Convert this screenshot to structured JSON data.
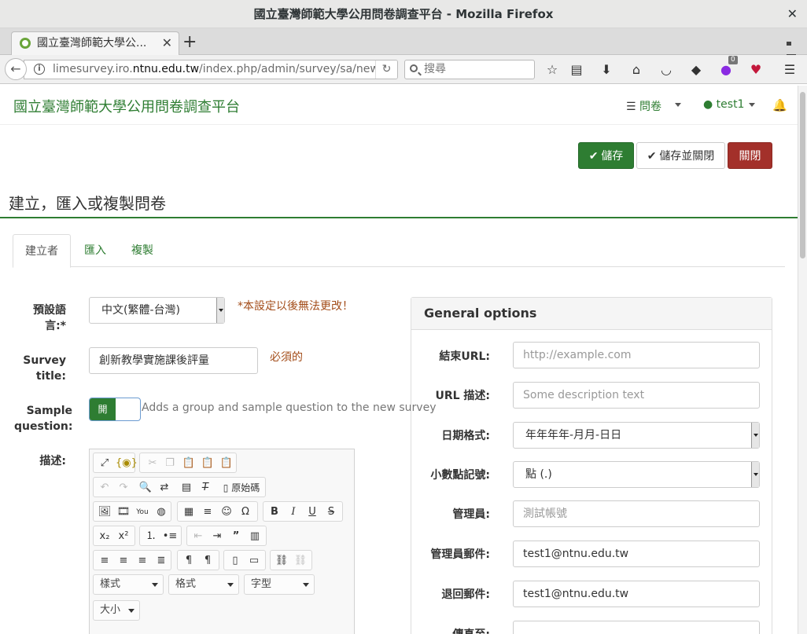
{
  "window": {
    "title": "國立臺灣師範大學公用問卷調查平台 - Mozilla Firefox",
    "close_glyph": "✕"
  },
  "browser": {
    "tab_title": "國立臺灣師範大學公...",
    "tab_close": "✕",
    "new_tab": "+",
    "url_prefix": "limesurvey.iro.",
    "url_host": "ntnu.edu.tw",
    "url_rest": "/index.php/admin/survey/sa/news",
    "search_placeholder": "搜尋",
    "addon_badge": "0"
  },
  "app": {
    "brand": "國立臺灣師範大學公用問卷調查平台",
    "nav_surveys": "問卷",
    "nav_user": "test1"
  },
  "actions": {
    "save": "儲存",
    "save_close": "儲存並關閉",
    "close": "關閉"
  },
  "page_title": "建立，匯入或複製問卷",
  "tabs": [
    "建立者",
    "匯入",
    "複製"
  ],
  "form": {
    "language_label": "預設語言:*",
    "language_value": "中文(繁體-台灣)",
    "language_note": "*本設定以後無法更改！",
    "title_label_1": "Survey",
    "title_label_2": "title:",
    "title_value": "創新教學實施課後評量",
    "title_required": "必須的",
    "sample_label_1": "Sample",
    "sample_label_2": "question:",
    "sample_toggle": "開",
    "sample_hint": "Adds a group and sample question to the new survey",
    "description_label": "描述:"
  },
  "editor": {
    "source_label": "原始碼",
    "styles_combo": "樣式",
    "format_combo": "格式",
    "font_combo": "字型",
    "size_combo": "大小"
  },
  "general_options": {
    "title": "General options",
    "end_url_label": "結束URL:",
    "end_url_placeholder": "http://example.com",
    "url_desc_label": "URL 描述:",
    "url_desc_placeholder": "Some description text",
    "date_format_label": "日期格式:",
    "date_format_value": "年年年年-月月-日日",
    "decimal_label": "小數點記號:",
    "decimal_value": "點 (.)",
    "admin_label": "管理員:",
    "admin_value": "測試帳號",
    "admin_email_label": "管理員郵件:",
    "admin_email_value": "test1@ntnu.edu.tw",
    "bounce_label": "退回郵件:",
    "bounce_value": "test1@ntnu.edu.tw",
    "fax_label": "傳真至:"
  },
  "colors": {
    "brand_green": "#2e7d32",
    "danger": "#a3302a",
    "note": "#a34d1a"
  }
}
